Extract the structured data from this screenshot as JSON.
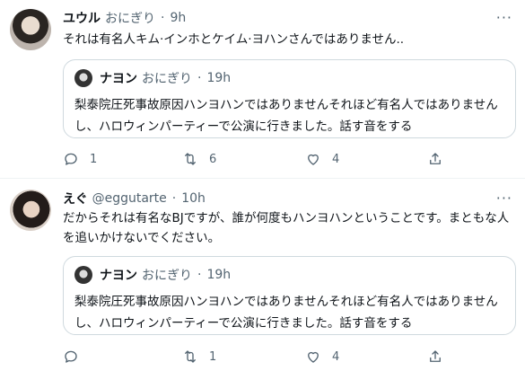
{
  "tweets": [
    {
      "name": "ユウル",
      "handle": "おにぎり",
      "dot": "·",
      "time": "9h",
      "more": "···",
      "text": "それは有名人キム·インホとケイム·ヨハンさんではありません..",
      "quote": {
        "name": "ナヨン",
        "handle": "おにぎり",
        "dot": "·",
        "time": "19h",
        "text": "梨泰院圧死事故原因ハンヨハンではありませんそれほど有名人ではありませんし、ハロウィンパーティーで公演に行きました。話す音をする"
      },
      "actions": {
        "reply_count": "1",
        "retweet_count": "6",
        "like_count": "4"
      }
    },
    {
      "name": "えぐ",
      "handle": "@eggutarte",
      "dot": "·",
      "time": "10h",
      "more": "···",
      "text": "だからそれは有名なBJですが、誰が何度もハンヨハンということです。まともな人を追いかけないでください。",
      "quote": {
        "name": "ナヨン",
        "handle": "おにぎり",
        "dot": "·",
        "time": "19h",
        "text": "梨泰院圧死事故原因ハンヨハンではありませんそれほど有名人ではありませんし、ハロウィンパーティーで公演に行きました。話す音をする"
      },
      "actions": {
        "reply_count": "",
        "retweet_count": "1",
        "like_count": "4"
      }
    }
  ],
  "icons": {
    "reply": "reply-icon",
    "retweet": "retweet-icon",
    "like": "heart-icon",
    "share": "share-icon"
  },
  "colors": {
    "text": "#0f1419",
    "secondary": "#536471",
    "border": "#cfd9de",
    "divider": "#eff3f4"
  }
}
